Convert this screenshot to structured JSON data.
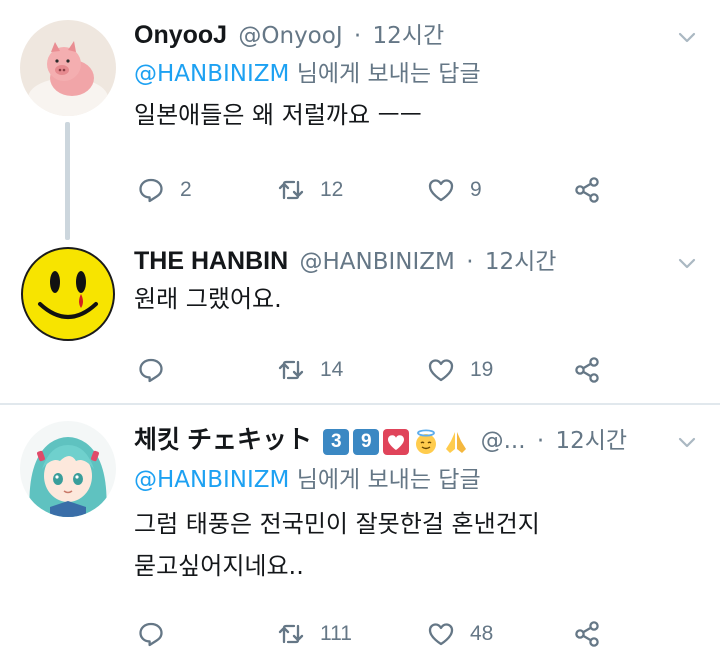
{
  "tweets": [
    {
      "name": "OnyooJ",
      "handle": "@OnyooJ",
      "dot": "·",
      "time": "12시간",
      "reply_handle": "@HANBINIZM",
      "reply_rest": " 님에게 보내는 답글",
      "lines": [
        "일본애들은 왜 저럴까요 ㅡㅡ"
      ],
      "replies": "2",
      "retweets": "12",
      "likes": "9",
      "avatar_icon": "pig-avatar-icon"
    },
    {
      "name": "THE HANBIN",
      "handle": "@HANBINIZM",
      "dot": "·",
      "time": "12시간",
      "lines": [
        "원래 그랬어요."
      ],
      "replies": "",
      "retweets": "14",
      "likes": "19",
      "avatar_icon": "smiley-avatar-icon"
    },
    {
      "name": "체킷 チェキット",
      "badge1": "3",
      "badge2": "9",
      "handle": "@...",
      "dot": "·",
      "time": "12시간",
      "reply_handle": "@HANBINIZM",
      "reply_rest": " 님에게 보내는 답글",
      "lines": [
        "그럼 태풍은 전국민이 잘못한걸 혼낸건지",
        "묻고싶어지네요.."
      ],
      "replies": "",
      "retweets": "111",
      "likes": "48",
      "avatar_icon": "anime-avatar-icon"
    }
  ],
  "colors": {
    "accent": "#1da1f2",
    "muted": "#657786",
    "text": "#14171a",
    "line": "#ccd6dd"
  }
}
